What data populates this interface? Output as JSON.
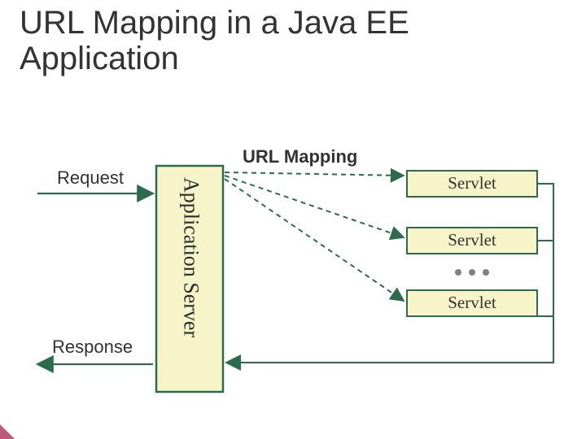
{
  "title_line1": "URL Mapping in a Java EE",
  "title_line2": "Application",
  "labels": {
    "request": "Request",
    "response": "Response",
    "url_mapping": "URL Mapping",
    "app_server": "Application Server"
  },
  "servlets": [
    "Servlet",
    "Servlet",
    "Servlet"
  ]
}
